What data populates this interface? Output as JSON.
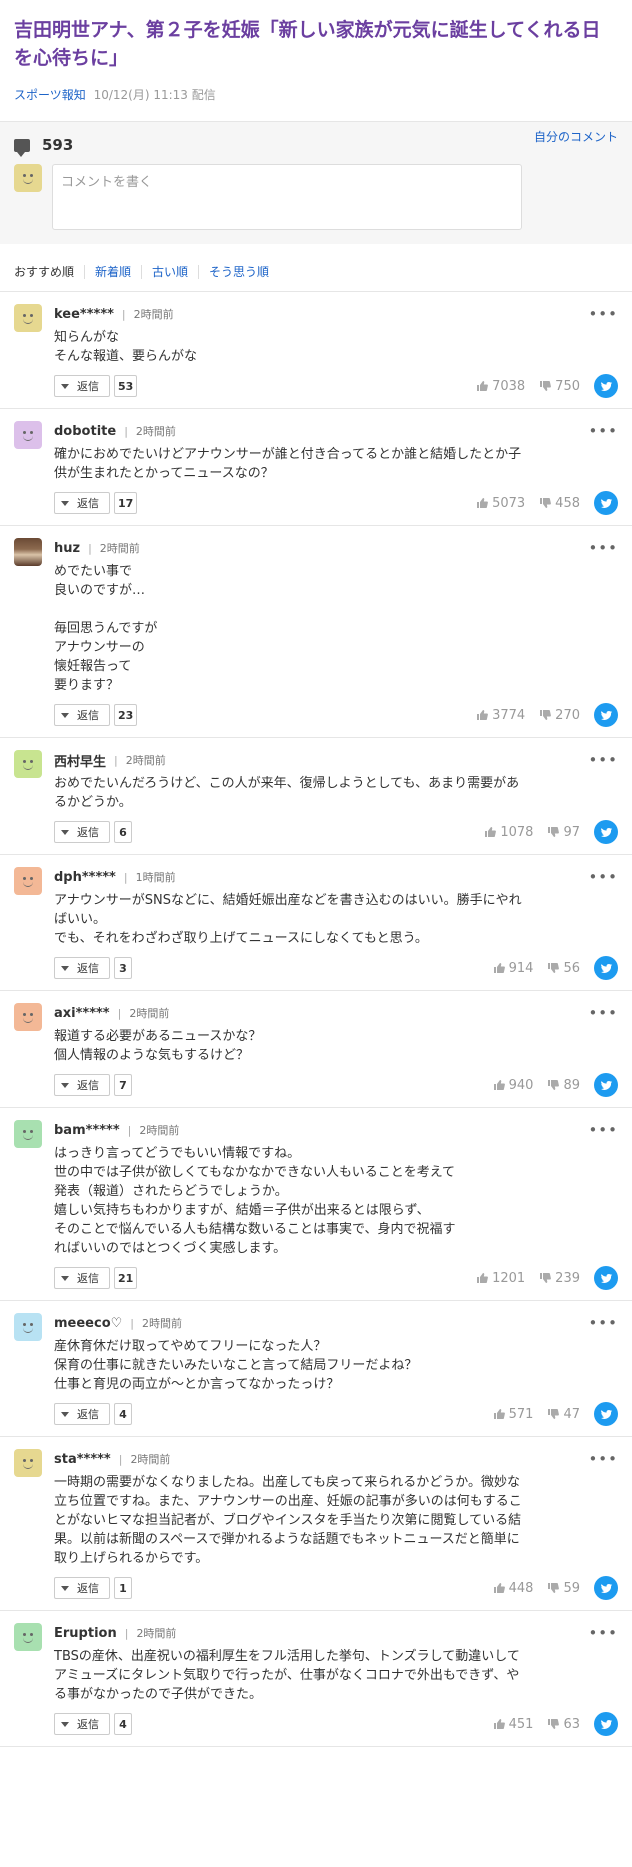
{
  "article": {
    "title": "吉田明世アナ、第２子を妊娠「新しい家族が元気に誕生してくれる日を心待ちに」",
    "source": "スポーツ報知",
    "date": "10/12(月) 11:13 配信"
  },
  "comment_box": {
    "count": "593",
    "my_comment_link": "自分のコメント",
    "placeholder": "コメントを書く"
  },
  "sort_tabs": [
    "おすすめ順",
    "新着順",
    "古い順",
    "そう思う順"
  ],
  "reply_label": "返信",
  "comments": [
    {
      "name": "kee*****",
      "time": "2時間前",
      "avatar_color": "#e6d890",
      "lines": [
        "知らんがな",
        "そんな報道、要らんがな"
      ],
      "replies": "53",
      "likes": "7038",
      "dislikes": "750"
    },
    {
      "name": "dobotite",
      "time": "2時間前",
      "avatar_color": "#dcc0ea",
      "lines": [
        "確かにおめでたいけどアナウンサーが誰と付き合ってるとか誰と結婚したとか子",
        "供が生まれたとかってニュースなの？"
      ],
      "replies": "17",
      "likes": "5073",
      "dislikes": "458"
    },
    {
      "name": "huz",
      "time": "2時間前",
      "avatar_color": "photo",
      "lines": [
        "めでたい事で",
        "良いのですが…",
        "",
        "毎回思うんですが",
        "アナウンサーの",
        "懐妊報告って",
        "要ります？"
      ],
      "replies": "23",
      "likes": "3774",
      "dislikes": "270"
    },
    {
      "name": "西村早生",
      "time": "2時間前",
      "avatar_color": "#c8e490",
      "lines": [
        "おめでたいんだろうけど、この人が来年、復帰しようとしても、あまり需要があ",
        "るかどうか。"
      ],
      "replies": "6",
      "likes": "1078",
      "dislikes": "97"
    },
    {
      "name": "dph*****",
      "time": "1時間前",
      "avatar_color": "#f3b896",
      "lines": [
        "アナウンサーがSNSなどに、結婚妊娠出産などを書き込むのはいい。勝手にやれ",
        "ばいい。",
        "でも、それをわざわざ取り上げてニュースにしなくてもと思う。"
      ],
      "replies": "3",
      "likes": "914",
      "dislikes": "56"
    },
    {
      "name": "axi*****",
      "time": "2時間前",
      "avatar_color": "#f3b896",
      "lines": [
        "報道する必要があるニュースかな？",
        "個人情報のような気もするけど？"
      ],
      "replies": "7",
      "likes": "940",
      "dislikes": "89"
    },
    {
      "name": "bam*****",
      "time": "2時間前",
      "avatar_color": "#a8e0b0",
      "lines": [
        "はっきり言ってどうでもいい情報ですね。",
        "世の中では子供が欲しくてもなかなかできない人もいることを考えて",
        "発表（報道）されたらどうでしょうか。",
        "嬉しい気持ちもわかりますが、結婚＝子供が出来るとは限らず、",
        "そのことで悩んでいる人も結構な数いることは事実で、身内で祝福す",
        "ればいいのではとつくづく実感します。"
      ],
      "replies": "21",
      "likes": "1201",
      "dislikes": "239"
    },
    {
      "name": "meeeco♡",
      "time": "2時間前",
      "avatar_color": "#b8e2f3",
      "lines": [
        "産休育休だけ取ってやめてフリーになった人？",
        "保育の仕事に就きたいみたいなこと言って結局フリーだよね？",
        "仕事と育児の両立が〜とか言ってなかったっけ？"
      ],
      "replies": "4",
      "likes": "571",
      "dislikes": "47"
    },
    {
      "name": "sta*****",
      "time": "2時間前",
      "avatar_color": "#e6d890",
      "lines": [
        "一時期の需要がなくなりましたね。出産しても戻って来られるかどうか。微妙な",
        "立ち位置ですね。また、アナウンサーの出産、妊娠の記事が多いのは何もするこ",
        "とがないヒマな担当記者が、ブログやインスタを手当たり次第に閲覧している結",
        "果。以前は新聞のスペースで弾かれるような話題でもネットニュースだと簡単に",
        "取り上げられるからです。"
      ],
      "replies": "1",
      "likes": "448",
      "dislikes": "59"
    },
    {
      "name": "Eruption",
      "time": "2時間前",
      "avatar_color": "#a8e0b0",
      "lines": [
        "TBSの産休、出産祝いの福利厚生をフル活用した挙句、トンズラして動違いして",
        "アミューズにタレント気取りで行ったが、仕事がなくコロナで外出もできず、や",
        "る事がなかったので子供ができた。"
      ],
      "replies": "4",
      "likes": "451",
      "dislikes": "63"
    }
  ]
}
